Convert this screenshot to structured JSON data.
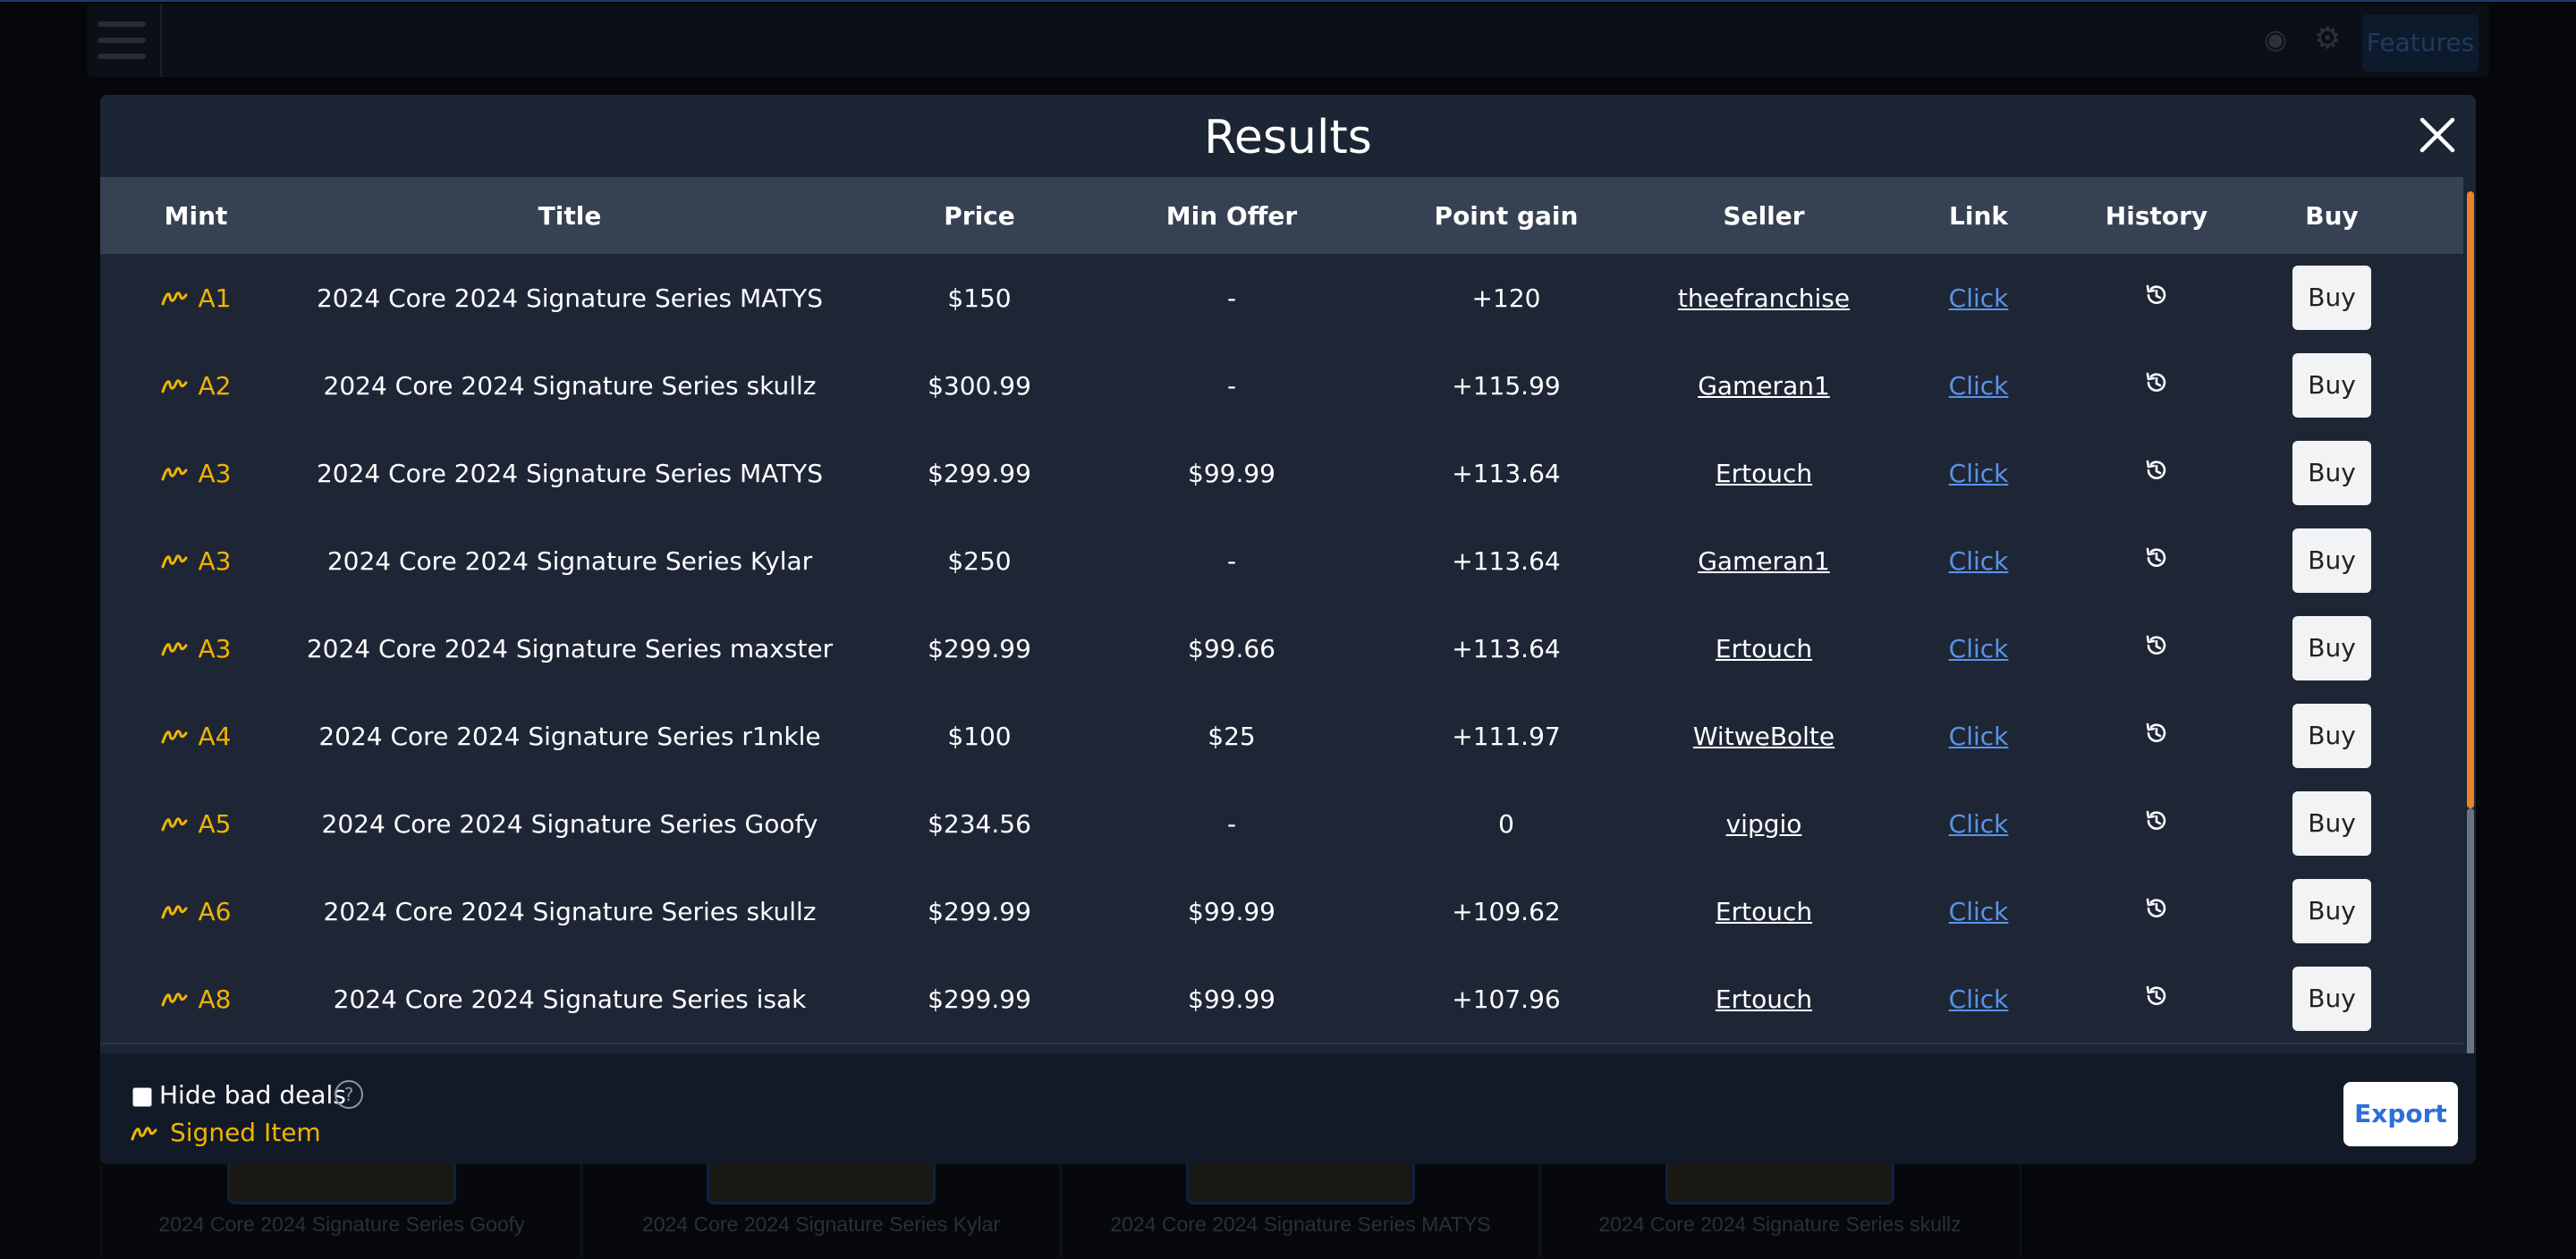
{
  "background": {
    "features_label": "Features",
    "cards": [
      {
        "title": "2024 Core 2024 Signature Series Goofy"
      },
      {
        "title": "2024 Core 2024 Signature Series Kylar"
      },
      {
        "title": "2024 Core 2024 Signature Series MATYS"
      },
      {
        "title": "2024 Core 2024 Signature Series skullz"
      }
    ]
  },
  "modal": {
    "title": "Results",
    "columns": [
      "Mint",
      "Title",
      "Price",
      "Min Offer",
      "Point gain",
      "Seller",
      "Link",
      "History",
      "Buy"
    ],
    "rows": [
      {
        "mint": "A1",
        "title": "2024 Core 2024 Signature Series MATYS",
        "price": "$150",
        "min_offer": "-",
        "point_gain": "+120",
        "seller": "theefranchise",
        "link": "Click",
        "buy": "Buy"
      },
      {
        "mint": "A2",
        "title": "2024 Core 2024 Signature Series skullz",
        "price": "$300.99",
        "min_offer": "-",
        "point_gain": "+115.99",
        "seller": "Gameran1",
        "link": "Click",
        "buy": "Buy"
      },
      {
        "mint": "A3",
        "title": "2024 Core 2024 Signature Series MATYS",
        "price": "$299.99",
        "min_offer": "$99.99",
        "point_gain": "+113.64",
        "seller": "Ertouch",
        "link": "Click",
        "buy": "Buy"
      },
      {
        "mint": "A3",
        "title": "2024 Core 2024 Signature Series Kylar",
        "price": "$250",
        "min_offer": "-",
        "point_gain": "+113.64",
        "seller": "Gameran1",
        "link": "Click",
        "buy": "Buy"
      },
      {
        "mint": "A3",
        "title": "2024 Core 2024 Signature Series maxster",
        "price": "$299.99",
        "min_offer": "$99.66",
        "point_gain": "+113.64",
        "seller": "Ertouch",
        "link": "Click",
        "buy": "Buy"
      },
      {
        "mint": "A4",
        "title": "2024 Core 2024 Signature Series r1nkle",
        "price": "$100",
        "min_offer": "$25",
        "point_gain": "+111.97",
        "seller": "WitweBolte",
        "link": "Click",
        "buy": "Buy"
      },
      {
        "mint": "A5",
        "title": "2024 Core 2024 Signature Series Goofy",
        "price": "$234.56",
        "min_offer": "-",
        "point_gain": "0",
        "seller": "vipgio",
        "link": "Click",
        "buy": "Buy"
      },
      {
        "mint": "A6",
        "title": "2024 Core 2024 Signature Series skullz",
        "price": "$299.99",
        "min_offer": "$99.99",
        "point_gain": "+109.62",
        "seller": "Ertouch",
        "link": "Click",
        "buy": "Buy"
      },
      {
        "mint": "A8",
        "title": "2024 Core 2024 Signature Series isak",
        "price": "$299.99",
        "min_offer": "$99.99",
        "point_gain": "+107.96",
        "seller": "Ertouch",
        "link": "Click",
        "buy": "Buy"
      }
    ],
    "footer": {
      "hide_bad_deals_label": "Hide bad deals",
      "hide_bad_deals_checked": false,
      "help_glyph": "?",
      "legend_label": "Signed Item",
      "export_label": "Export"
    },
    "colors": {
      "accent_signed": "#f0b400",
      "link": "#5a93e8",
      "scrollbar": "#e8822d"
    }
  }
}
